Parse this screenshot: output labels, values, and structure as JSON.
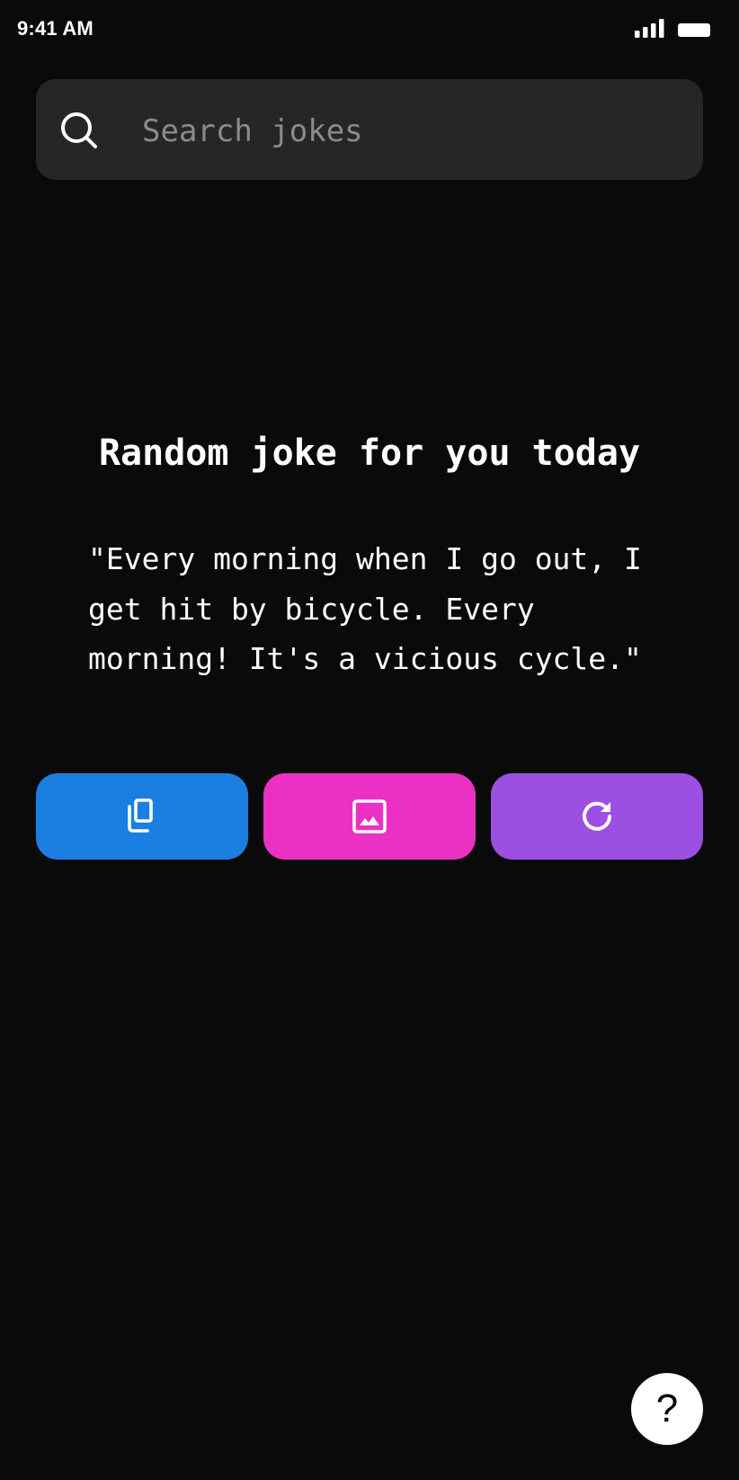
{
  "status_bar": {
    "time": "9:41 AM",
    "icons": [
      "signal-icon",
      "battery-icon"
    ]
  },
  "search": {
    "placeholder": "Search jokes",
    "value": "",
    "icon": "search-icon"
  },
  "joke": {
    "title": "Random joke for you today",
    "text": "\"Every morning when I go out, I\nget hit by bicycle. Every\nmorning! It's a vicious cycle.\""
  },
  "actions": [
    {
      "name": "copy",
      "icon": "copy-icon",
      "color": "#1a7fe0"
    },
    {
      "name": "image",
      "icon": "image-icon",
      "color": "#eb31c3"
    },
    {
      "name": "refresh",
      "icon": "refresh-icon",
      "color": "#9c4fe0"
    }
  ],
  "help": {
    "label": "?",
    "color": "#ffffff"
  },
  "colors": {
    "background": "#0b0a0b",
    "search_background": "#272527",
    "placeholder": "#8c8a8c",
    "text": "#ffffff"
  }
}
